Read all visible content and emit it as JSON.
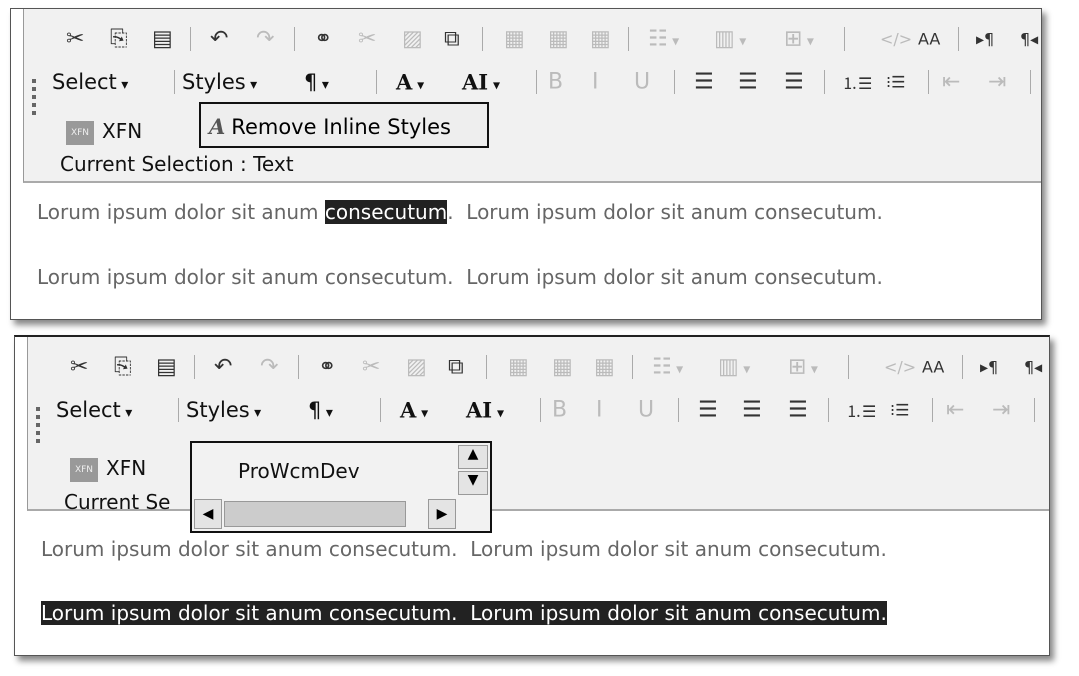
{
  "panels": [
    {
      "status": "Current Selection : Text",
      "xfn": "XFN",
      "remove_inline_styles": "Remove Inline Styles",
      "line1_before": "Lorum ipsum dolor sit anum ",
      "line1_selected": "consecutum",
      "line1_after": ".  Lorum ipsum dolor sit anum consecutum.",
      "line2": "Lorum ipsum dolor sit anum consecutum.  Lorum ipsum dolor sit anum consecutum."
    },
    {
      "status": "Current Se",
      "xfn": "XFN",
      "popup_value": "ProWcmDev",
      "line1": "Lorum ipsum dolor sit anum consecutum.  Lorum ipsum dolor sit anum consecutum.",
      "line2_selected": "Lorum ipsum dolor sit anum consecutum.  Lorum ipsum dolor sit anum consecutum."
    }
  ],
  "toolbar_row1": [
    {
      "icon": "cut-icon",
      "glyph": "✂"
    },
    {
      "icon": "copy-icon",
      "glyph": "⎘"
    },
    {
      "icon": "paste-icon",
      "glyph": "▤"
    },
    {
      "sep": true
    },
    {
      "icon": "undo-icon",
      "glyph": "↶"
    },
    {
      "icon": "redo-icon",
      "glyph": "↷",
      "disabled": true
    },
    {
      "sep": true
    },
    {
      "icon": "hyperlink-icon",
      "glyph": "⚭"
    },
    {
      "icon": "remove-link-icon",
      "glyph": "✂",
      "disabled": true
    },
    {
      "icon": "image-icon",
      "glyph": "▨",
      "disabled": true
    },
    {
      "icon": "paste-from-word-icon",
      "glyph": "⧉"
    },
    {
      "sep": true
    },
    {
      "icon": "insert-table-icon",
      "glyph": "▦",
      "disabled": true
    },
    {
      "icon": "table-properties-icon",
      "glyph": "▦",
      "disabled": true
    },
    {
      "icon": "cell-properties-icon",
      "glyph": "▦",
      "disabled": true
    },
    {
      "sep": true
    },
    {
      "icon": "insert-row-icon",
      "glyph": "☷",
      "disabled": true,
      "dropdown": true
    },
    {
      "icon": "insert-column-icon",
      "glyph": "▥",
      "disabled": true,
      "dropdown": true
    },
    {
      "icon": "split-cell-icon",
      "glyph": "⊞",
      "disabled": true,
      "dropdown": true
    },
    {
      "sep": true
    },
    {
      "icon": "source-icon",
      "glyph": "</>",
      "disabled": true
    },
    {
      "icon": "remove-styles-icon",
      "glyph": "AA"
    },
    {
      "sep": true
    },
    {
      "icon": "ltr-icon",
      "glyph": "▸¶"
    },
    {
      "icon": "rtl-icon",
      "glyph": "¶◂"
    }
  ],
  "toolbar_row2": [
    {
      "label": "Select",
      "dropdown": true
    },
    {
      "sep": true
    },
    {
      "label": "Styles",
      "dropdown": true
    },
    {
      "label": "¶",
      "dropdown": true
    },
    {
      "sep": true
    },
    {
      "label": "A",
      "dropdown": true,
      "serif": true
    },
    {
      "label": "AI",
      "dropdown": true,
      "serif": true
    },
    {
      "sep": true
    },
    {
      "icon": "bold-icon",
      "glyph": "B",
      "disabled": true
    },
    {
      "icon": "italic-icon",
      "glyph": "I",
      "disabled": true
    },
    {
      "icon": "underline-icon",
      "glyph": "U",
      "disabled": true
    },
    {
      "sep": true
    },
    {
      "icon": "align-left-icon",
      "glyph": "☰"
    },
    {
      "icon": "align-center-icon",
      "glyph": "☰"
    },
    {
      "icon": "align-right-icon",
      "glyph": "☰"
    },
    {
      "sep": true
    },
    {
      "icon": "ordered-list-icon",
      "glyph": "⒈☰"
    },
    {
      "icon": "unordered-list-icon",
      "glyph": "⁝☰"
    },
    {
      "sep": true
    },
    {
      "icon": "outdent-icon",
      "glyph": "⇤",
      "disabled": true
    },
    {
      "icon": "indent-icon",
      "glyph": "⇥",
      "disabled": true
    },
    {
      "sep": true
    }
  ]
}
